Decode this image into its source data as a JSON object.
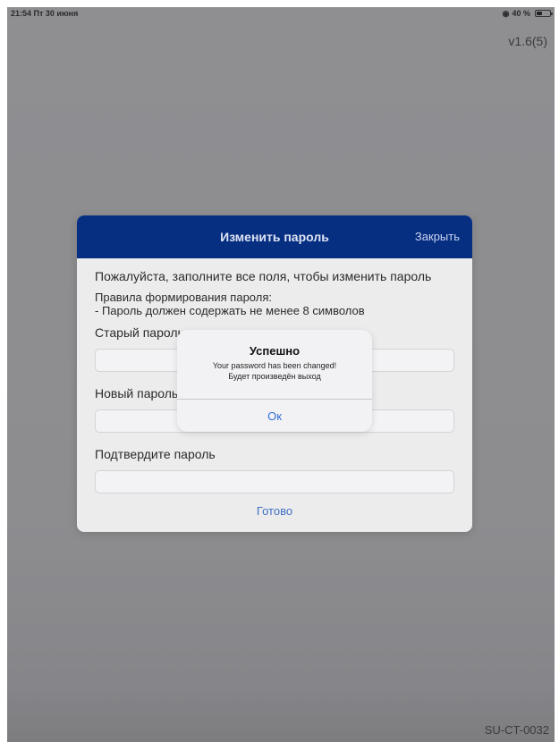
{
  "status_bar": {
    "time": "21:54",
    "date": "Пт 30 июня",
    "battery": "40 %",
    "icons": [
      "wifi-icon",
      "battery-icon"
    ]
  },
  "app": {
    "version": "v1.6(5)",
    "device_id": "SU-CT-0032"
  },
  "change_password_dialog": {
    "title": "Изменить пароль",
    "close_label": "Закрыть",
    "intro": "Пожалуйста, заполните все поля, чтобы изменить пароль",
    "rules_heading": "Правила формирования пароля:",
    "rules_item": "- Пароль должен содержать не менее 8 символов",
    "fields": [
      {
        "label": "Старый пароль",
        "value": ""
      },
      {
        "label": "Новый пароль",
        "value": ""
      },
      {
        "label": "Подтвердите пароль",
        "value": ""
      }
    ],
    "done_label": "Готово",
    "header_color": "#062f82"
  },
  "alert": {
    "title": "Успешно",
    "message_line1": "Your password has been changed!",
    "message_line2": "Будет произведён выход",
    "ok_label": "Ок",
    "button_color": "#2f6fd6"
  }
}
